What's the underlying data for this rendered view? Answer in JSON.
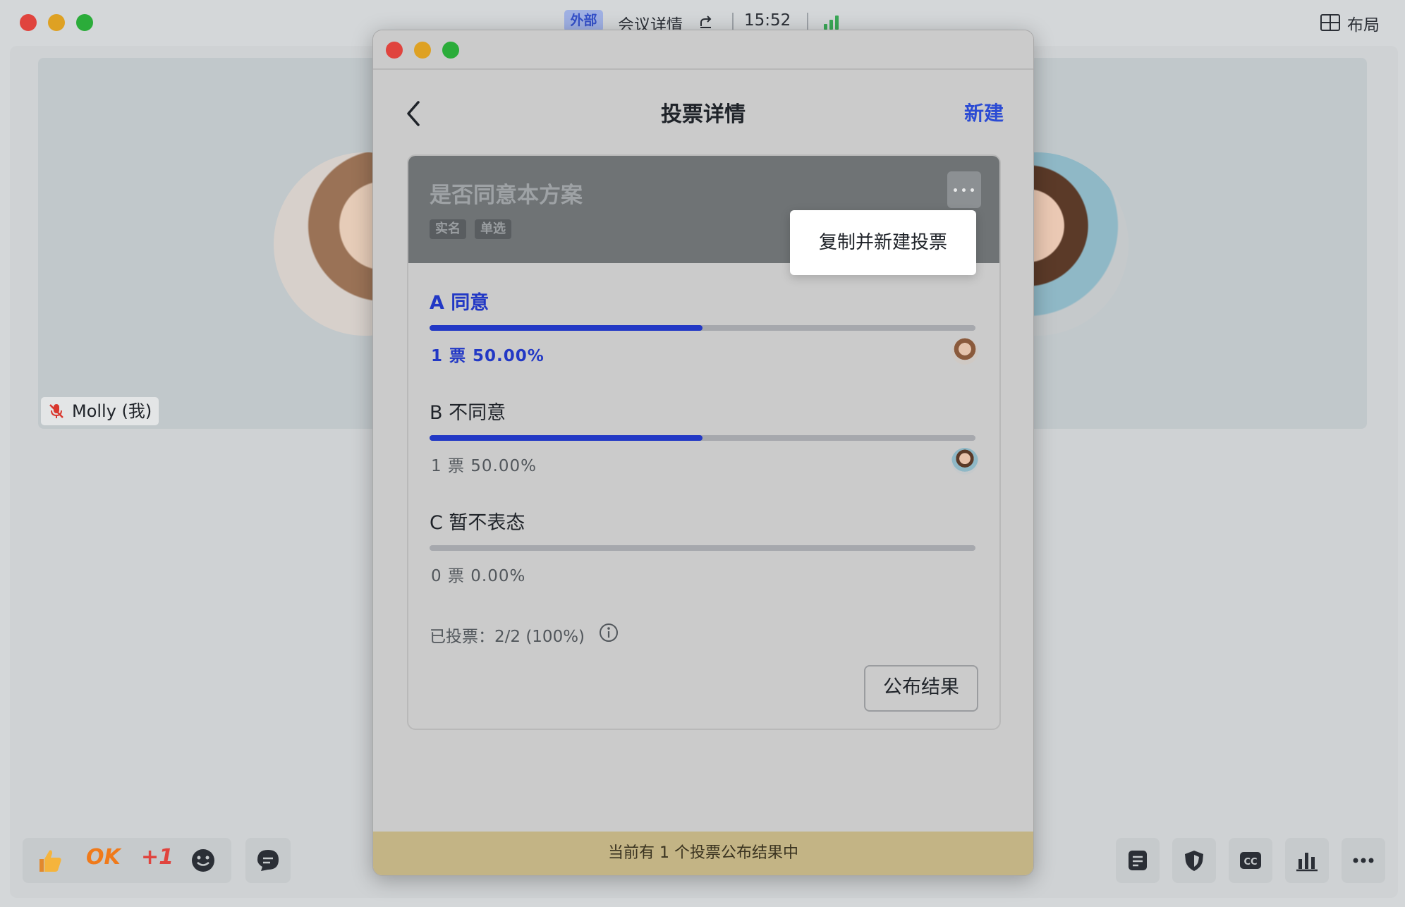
{
  "meeting": {
    "external_badge": "外部",
    "title": "会议详情",
    "time": "15:52",
    "layout_label": "布局",
    "participant_name": "Molly (我)",
    "reactions": [
      "OK",
      "+1"
    ],
    "colors": {
      "signal": "#3aa857",
      "accent": "#2238c5"
    }
  },
  "poll_window": {
    "title": "投票详情",
    "new_label": "新建",
    "question": "是否同意本方案",
    "tags": [
      "实名",
      "单选"
    ],
    "menu_item": "复制并新建投票",
    "options": [
      {
        "label": "A  同意",
        "stat": "1 票   50.00%",
        "fraction": 0.5,
        "selected": true
      },
      {
        "label": "B  不同意",
        "stat": "1 票   50.00%",
        "fraction": 0.5,
        "selected": false
      },
      {
        "label": "C  暂不表态",
        "stat": "0 票   0.00%",
        "fraction": 0,
        "selected": false
      }
    ],
    "voted_summary": "已投票：2/2 (100%)",
    "publish_label": "公布结果",
    "banner": "当前有 1 个投票公布结果中"
  }
}
